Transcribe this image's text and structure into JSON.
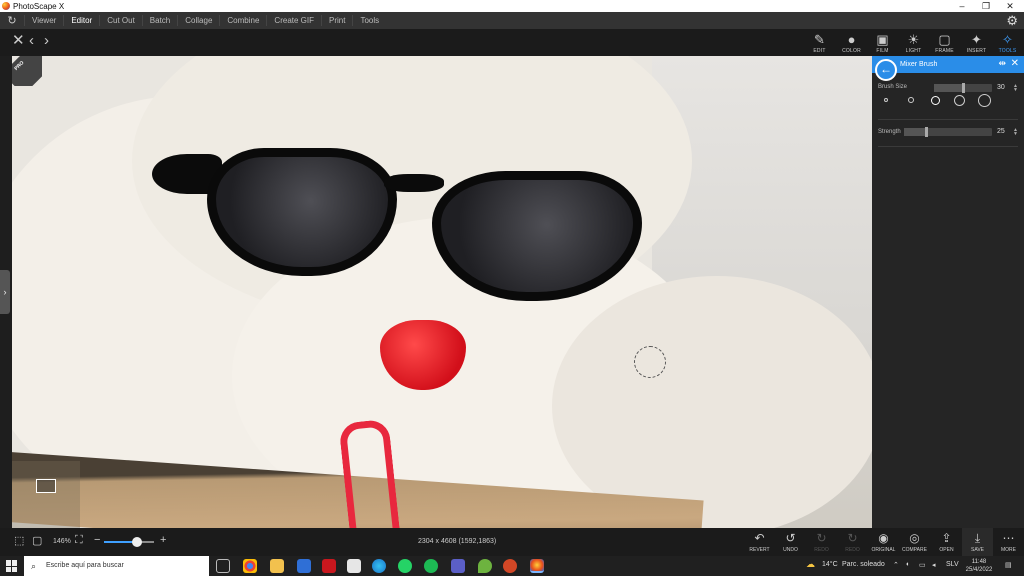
{
  "window": {
    "title": "PhotoScape X",
    "controls": [
      "–",
      "❐",
      "✕"
    ]
  },
  "menu": {
    "items": [
      "Viewer",
      "Editor",
      "Cut Out",
      "Batch",
      "Collage",
      "Combine",
      "Create GIF",
      "Print",
      "Tools"
    ],
    "active": "Editor"
  },
  "tool_tabs": [
    {
      "label": "EDIT",
      "icon": "✎"
    },
    {
      "label": "COLOR",
      "icon": "●"
    },
    {
      "label": "FILM",
      "icon": "▣"
    },
    {
      "label": "LIGHT",
      "icon": "☀"
    },
    {
      "label": "FRAME",
      "icon": "▢"
    },
    {
      "label": "INSERT",
      "icon": "✦"
    },
    {
      "label": "TOOLS",
      "icon": "✧"
    }
  ],
  "active_tab": "TOOLS",
  "canvas": {
    "badge": "PRO"
  },
  "panel": {
    "title": "Mixer Brush",
    "brush_size": {
      "label": "Brush Size",
      "value": "30",
      "level_percent": 50
    },
    "strength": {
      "label": "Strength",
      "value": "25",
      "level_percent": 25
    }
  },
  "bottom": {
    "zoom": "146%",
    "zoom_level_percent": 65,
    "image_info": "2304 x 4608 (1592,1863)",
    "actions": [
      {
        "label": "REVERT",
        "icon": "↶",
        "enabled": true
      },
      {
        "label": "UNDO",
        "icon": "↺",
        "enabled": true
      },
      {
        "label": "REDO",
        "icon": "↻",
        "enabled": false
      },
      {
        "label": "REDO",
        "icon": "↻",
        "enabled": false
      },
      {
        "label": "ORIGINAL",
        "icon": "◉",
        "enabled": true
      },
      {
        "label": "COMPARE",
        "icon": "◎",
        "enabled": true
      },
      {
        "label": "OPEN",
        "icon": "⇪",
        "enabled": true
      },
      {
        "label": "SAVE",
        "icon": "⤓",
        "enabled": true
      },
      {
        "label": "MORE",
        "icon": "⋯",
        "enabled": true
      }
    ]
  },
  "taskbar": {
    "search_placeholder": "Escribe aquí para buscar",
    "weather_temp": "14°C",
    "weather_text": "Parc. soleado",
    "lang": "SLV",
    "time": "11:48",
    "date": "25/4/2022"
  }
}
